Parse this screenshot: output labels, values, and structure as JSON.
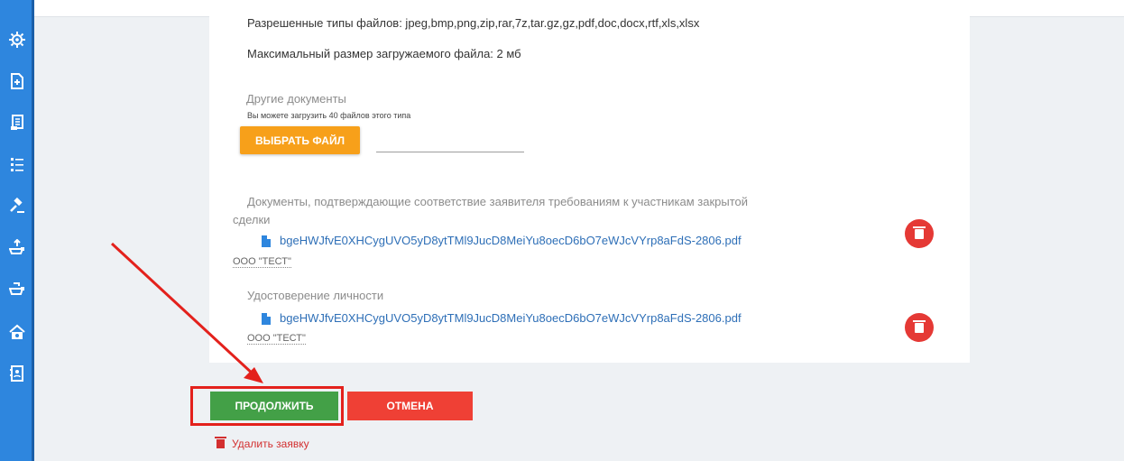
{
  "sidebar": {
    "icons": [
      "gear-icon",
      "document-add-icon",
      "scroll-icon",
      "list-icon",
      "gavel-icon",
      "boat-up-icon",
      "boat-icon",
      "house-money-icon",
      "contact-book-icon"
    ]
  },
  "info": {
    "allowed_types": "Разрешенные типы файлов: jpeg,bmp,png,zip,rar,7z,tar.gz,gz,pdf,doc,docx,rtf,xls,xlsx",
    "max_size": "Максимальный размер загружаемого файла: 2 мб"
  },
  "other_docs": {
    "title": "Другие документы",
    "hint": "Вы можете загрузить 40 файлов этого типа",
    "choose_button": "ВЫБРАТЬ ФАЙЛ"
  },
  "compliance_docs": {
    "title_line1": "Документы, подтверждающие соответствие заявителя требованиям к участникам закрытой",
    "title_line2": "сделки",
    "file_name": "bgeHWJfvE0XHCygUVO5yD8ytTMl9JucD8MeiYu8oecD6bO7eWJcVYrp8aFdS-2806.pdf",
    "owner": "ООО \"ТЕСТ\""
  },
  "identity_docs": {
    "title": "Удостоверение личности",
    "file_name": "bgeHWJfvE0XHCygUVO5yD8ytTMl9JucD8MeiYu8oecD6bO7eWJcVYrp8aFdS-2806.pdf",
    "owner": "ООО \"ТЕСТ\""
  },
  "actions": {
    "continue_label": "ПРОДОЛЖИТЬ",
    "cancel_label": "ОТМЕНА",
    "delete_application": "Удалить заявку"
  },
  "colors": {
    "sidebar": "#2e86de",
    "choose_button": "#f7a01a",
    "continue_button": "#43a047",
    "cancel_button": "#ef4035",
    "annotation": "#e3211c"
  }
}
